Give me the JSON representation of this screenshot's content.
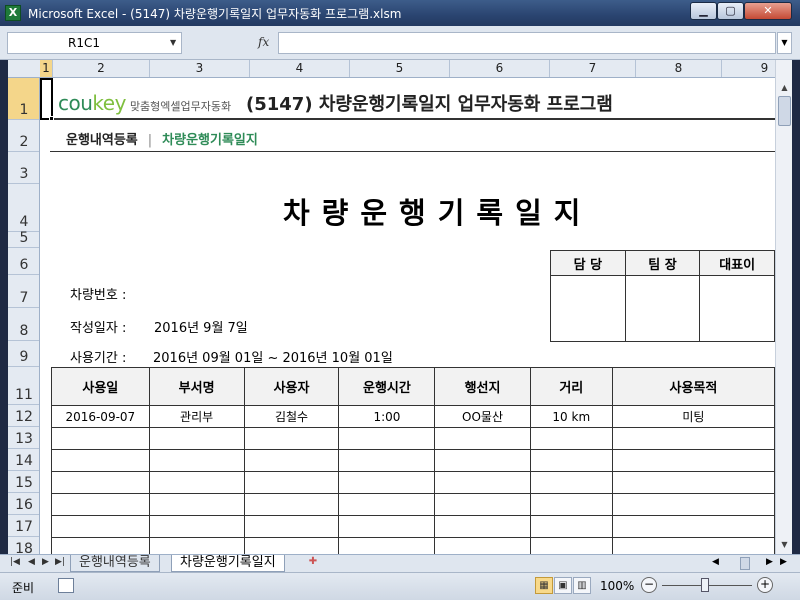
{
  "window": {
    "title": "Microsoft Excel - (5147) 차량운행기록일지 업무자동화 프로그램.xlsm",
    "app_icon": "X",
    "minimize": "▁",
    "maximize": "▢",
    "close": "✕"
  },
  "formula_bar": {
    "name_box": "R1C1",
    "fx_label": "fx",
    "formula": ""
  },
  "columns": [
    "1",
    "2",
    "3",
    "4",
    "5",
    "6",
    "7",
    "8",
    "9"
  ],
  "rows": [
    "1",
    "2",
    "3",
    "4",
    "5",
    "6",
    "7",
    "8",
    "9",
    "11",
    "12",
    "13",
    "14",
    "15",
    "16",
    "17",
    "18"
  ],
  "sheet": {
    "logo_text_1": "cou",
    "logo_text_2": "key",
    "logo_sub": "맞춤형엑셀업무자동화",
    "program_title": "(5147) 차량운행기록일지 업무자동화 프로그램",
    "nav_link_1": "운행내역등록",
    "nav_separator": "|",
    "nav_link_2": "차량운행기록일지",
    "doc_title": "차량운행기록일지",
    "approval_headers": [
      "담 당",
      "팀 장",
      "대표이"
    ],
    "vehicle_label": "차량번호 :",
    "date_label": "작성일자 :",
    "date_value": "2016년 9월 7일",
    "period_label": "사용기간 :",
    "period_value": "2016년 09월 01일 ~ 2016년 10월 01일",
    "table_headers": [
      "사용일",
      "부서명",
      "사용자",
      "운행시간",
      "행선지",
      "거리",
      "사용목적"
    ],
    "table_rows": [
      [
        "2016-09-07",
        "관리부",
        "김철수",
        "1:00",
        "OO물산",
        "10 km",
        "미팅"
      ]
    ]
  },
  "tabs": {
    "tab_1": "운행내역등록",
    "tab_2": "차량운행기록일지"
  },
  "status": {
    "ready": "준비",
    "zoom": "100%"
  }
}
